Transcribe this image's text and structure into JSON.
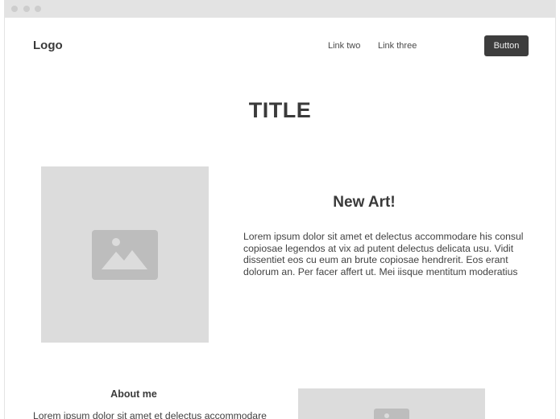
{
  "header": {
    "logo": "Logo",
    "nav": [
      {
        "label": "Link two"
      },
      {
        "label": "Link three"
      }
    ],
    "button_label": "Button"
  },
  "hero": {
    "title": "TITLE"
  },
  "feature": {
    "image_icon": "image-icon",
    "heading": "New Art!",
    "text": "Lorem ipsum dolor sit amet et delectus accommodare his consul copiosae legendos at vix ad putent delectus delicata usu. Vidit dissentiet eos cu eum an brute copiosae hendrerit. Eos erant dolorum an. Per facer affert ut. Mei iisque mentitum moderatius"
  },
  "about": {
    "heading": "About me",
    "text": "Lorem ipsum dolor sit amet et delectus accommodare",
    "image_icon": "image-icon"
  },
  "colors": {
    "button_bg": "#3d3d3d",
    "placeholder_bg": "#dcdcdc",
    "placeholder_icon": "#bdbdbd",
    "titlebar": "#e3e3e3"
  }
}
